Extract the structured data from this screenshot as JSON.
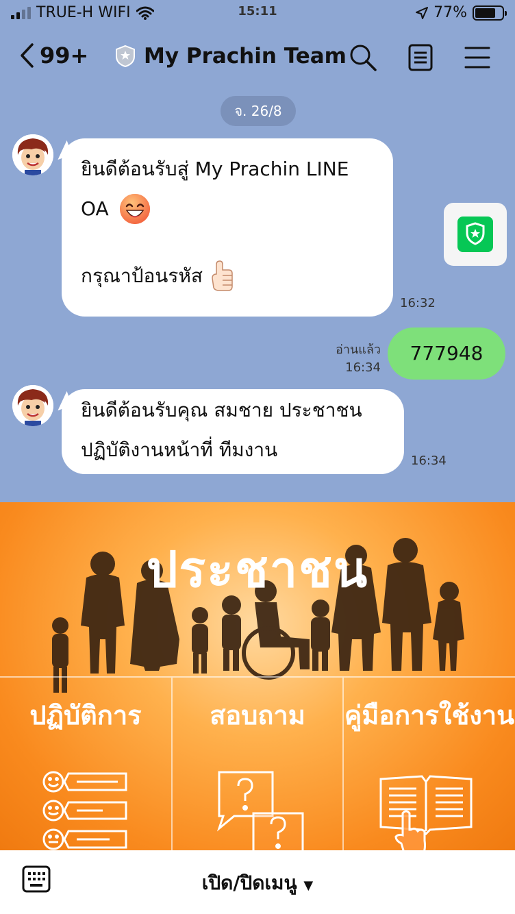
{
  "status_bar": {
    "carrier": "TRUE-H WIFI",
    "time": "15:11",
    "battery": "77%",
    "battery_level": 0.77
  },
  "header": {
    "unread_count": "99+",
    "chat_title": "My Prachin Team"
  },
  "chat": {
    "date_label": "จ. 26/8",
    "messages": [
      {
        "line1": "ยินดีต้อนรับสู่ My Prachin LINE",
        "line2": "OA",
        "line3": "กรุณาป้อนรหัส",
        "time": "16:32"
      },
      {
        "text": "777948",
        "read_label": "อ่านแล้ว",
        "time": "16:34"
      },
      {
        "line1": "ยินดีต้อนรับคุณ สมชาย ประชาชน",
        "line2": "ปฏิบัติงานหน้าที่ ทีมงาน",
        "time": "16:34"
      }
    ]
  },
  "rich_menu": {
    "title": "ประชาชน",
    "items": [
      {
        "label": "ปฏิบัติการ",
        "icon": "faces-checklist-icon"
      },
      {
        "label": "สอบถาม",
        "icon": "question-bubbles-icon"
      },
      {
        "label": "คู่มือการใช้งาน",
        "icon": "manual-book-icon"
      }
    ]
  },
  "bottom_bar": {
    "toggle_label": "เปิด/ปิดเมนู"
  },
  "colors": {
    "chat_bg": "#8ea7d3",
    "outgoing_bubble": "#7ee07a",
    "line_green": "#06c755",
    "menu_orange": "#f98a1e"
  }
}
